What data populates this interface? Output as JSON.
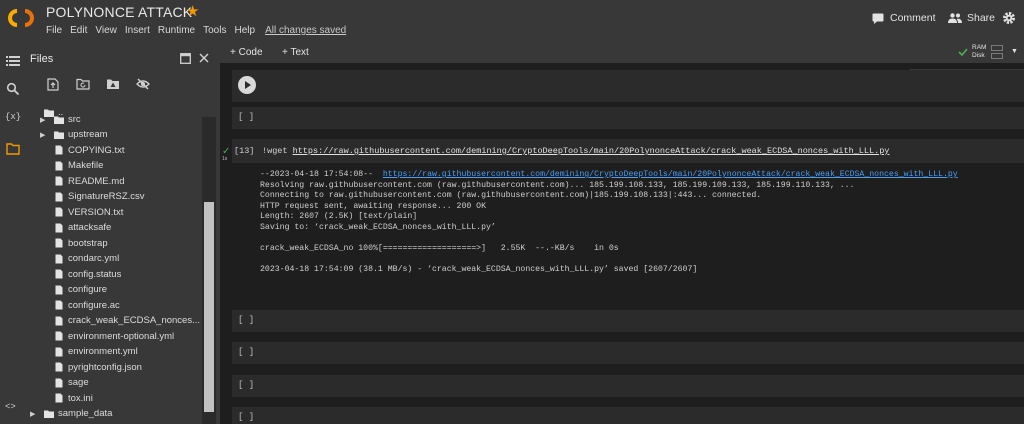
{
  "header": {
    "title": "POLYNONCE ATTACK",
    "menu": [
      "File",
      "Edit",
      "View",
      "Insert",
      "Runtime",
      "Tools",
      "Help"
    ],
    "save_status": "All changes saved",
    "comment_label": "Comment",
    "share_label": "Share"
  },
  "files_panel": {
    "title": "Files",
    "items": [
      {
        "label": "..",
        "type": "folder",
        "indent": 0
      },
      {
        "label": "src",
        "type": "folder",
        "indent": 1,
        "chevron": true
      },
      {
        "label": "upstream",
        "type": "folder",
        "indent": 1,
        "chevron": true
      },
      {
        "label": "COPYING.txt",
        "type": "file",
        "indent": 1
      },
      {
        "label": "Makefile",
        "type": "file",
        "indent": 1
      },
      {
        "label": "README.md",
        "type": "file",
        "indent": 1
      },
      {
        "label": "SignatureRSZ.csv",
        "type": "file",
        "indent": 1
      },
      {
        "label": "VERSION.txt",
        "type": "file",
        "indent": 1
      },
      {
        "label": "attacksafe",
        "type": "file",
        "indent": 1
      },
      {
        "label": "bootstrap",
        "type": "file",
        "indent": 1
      },
      {
        "label": "condarc.yml",
        "type": "file",
        "indent": 1
      },
      {
        "label": "config.status",
        "type": "file",
        "indent": 1
      },
      {
        "label": "configure",
        "type": "file",
        "indent": 1
      },
      {
        "label": "configure.ac",
        "type": "file",
        "indent": 1
      },
      {
        "label": "crack_weak_ECDSA_nonces...",
        "type": "file",
        "indent": 1
      },
      {
        "label": "environment-optional.yml",
        "type": "file",
        "indent": 1
      },
      {
        "label": "environment.yml",
        "type": "file",
        "indent": 1
      },
      {
        "label": "pyrightconfig.json",
        "type": "file",
        "indent": 1
      },
      {
        "label": "sage",
        "type": "file",
        "indent": 1
      },
      {
        "label": "tox.ini",
        "type": "file",
        "indent": 1
      },
      {
        "label": "sample_data",
        "type": "folder",
        "indent": 0,
        "chevron": true
      }
    ]
  },
  "toolbar": {
    "add_code": "+ Code",
    "add_text": "+ Text",
    "ram_label": "RAM",
    "disk_label": "Disk"
  },
  "cells": {
    "empty_marker": "[ ]",
    "code": {
      "exec_count": "[13]",
      "exec_time": "1s",
      "command": "!wget ",
      "url": "https://raw.githubusercontent.com/demining/CryptoDeepTools/main/20PolynonceAttack/crack_weak_ECDSA_nonces_with_LLL.py"
    },
    "output": {
      "line1_prefix": "--2023-04-18 17:54:08--  ",
      "line1_url": "https://raw.githubusercontent.com/demining/CryptoDeepTools/main/20PolynonceAttack/crack_weak_ECDSA_nonces_with_LLL.py",
      "line2": "Resolving raw.githubusercontent.com (raw.githubusercontent.com)... 185.199.108.133, 185.199.109.133, 185.199.110.133, ...",
      "line3": "Connecting to raw.githubusercontent.com (raw.githubusercontent.com)|185.199.108.133|:443... connected.",
      "line4": "HTTP request sent, awaiting response... 200 OK",
      "line5": "Length: 2607 (2.5K) [text/plain]",
      "line6": "Saving to: ‘crack_weak_ECDSA_nonces_with_LLL.py’",
      "line7": "crack_weak_ECDSA_no 100%[===================>]   2.55K  --.-KB/s    in 0s",
      "line8": "2023-04-18 17:54:09 (38.1 MB/s) - ‘crack_weak_ECDSA_nonces_with_LLL.py’ saved [2607/2607]"
    }
  },
  "colors": {
    "accent_orange": "#f29900",
    "link_blue": "#4a9ef5",
    "success_green": "#4caf50"
  }
}
